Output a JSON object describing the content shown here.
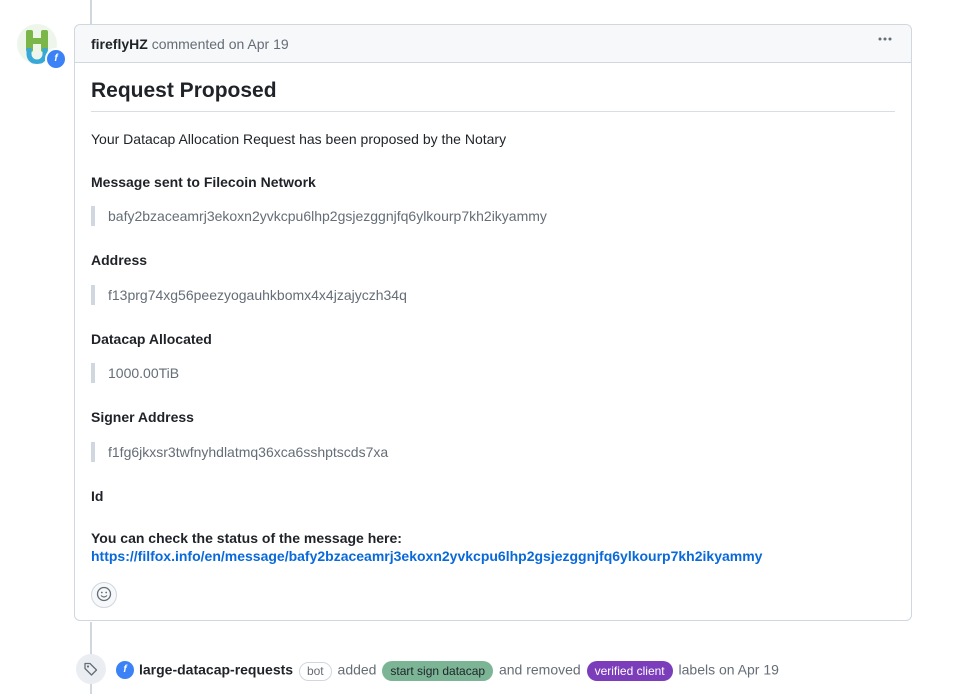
{
  "comment": {
    "author": "fireflyHZ",
    "action_text": "commented on Apr 19",
    "more_icon": "kebab-horizontal-icon",
    "title": "Request Proposed",
    "intro": "Your Datacap Allocation Request has been proposed by the Notary",
    "fields": [
      {
        "heading": "Message sent to Filecoin Network",
        "value": "bafy2bzaceamrj3ekoxn2yvkcpu6lhp2gsjezggnjfq6ylkourp7kh2ikyammy"
      },
      {
        "heading": "Address",
        "value": "f13prg74xg56peezyogauhkbomx4x4jzajyczh34q"
      },
      {
        "heading": "Datacap Allocated",
        "value": "1000.00TiB"
      },
      {
        "heading": "Signer Address",
        "value": "f1fg6jkxsr3twfnyhdlatmq36xca6sshptscds7xa"
      }
    ],
    "id_heading": "Id",
    "status_text": "You can check the status of the message here:",
    "status_link": "https://filfox.info/en/message/bafy2bzaceamrj3ekoxn2yvkcpu6lhp2gsjezggnjfq6ylkourp7kh2ikyammy",
    "reaction_icon": "smiley-icon"
  },
  "event": {
    "icon": "tag-icon",
    "actor": "large-datacap-requests",
    "bot_badge": "bot",
    "added_text": "added",
    "added_label": "start sign datacap",
    "removed_text": "and removed",
    "removed_label": "verified client",
    "suffix_text": "labels on Apr 19"
  },
  "colors": {
    "link": "#0969da",
    "label_green": "#7cb596",
    "label_purple": "#7b3dba",
    "app_badge": "#3b82f6"
  }
}
